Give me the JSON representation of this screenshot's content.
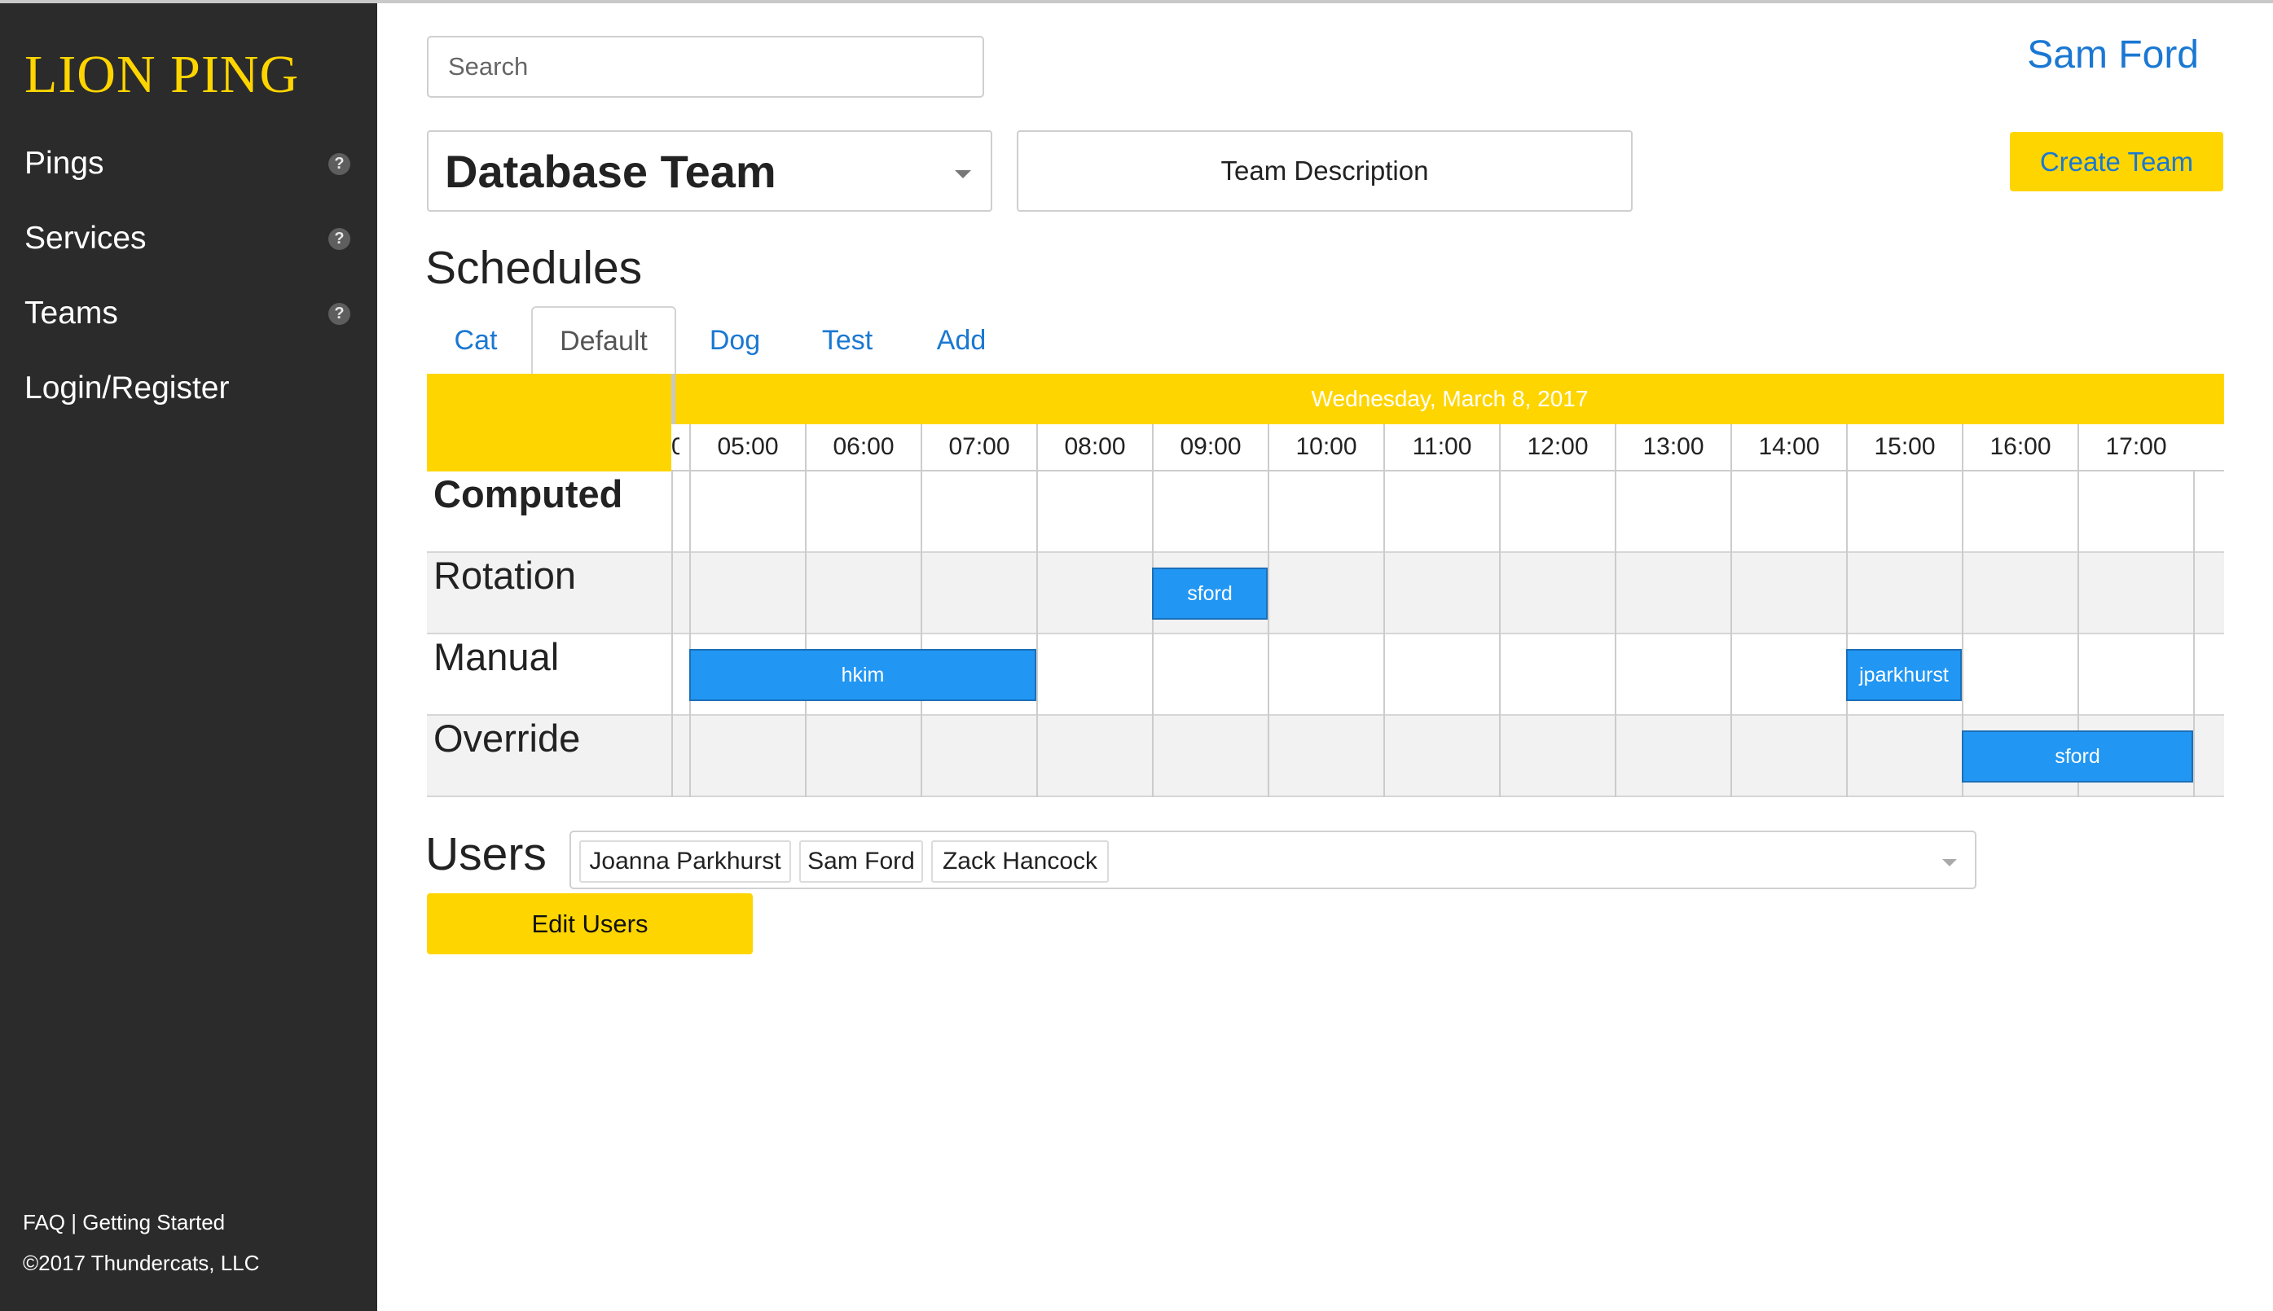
{
  "app": {
    "logo": "LION PING"
  },
  "sidebar": {
    "items": [
      {
        "label": "Pings",
        "has_help": true
      },
      {
        "label": "Services",
        "has_help": true
      },
      {
        "label": "Teams",
        "has_help": true
      },
      {
        "label": "Login/Register",
        "has_help": false
      }
    ],
    "help_glyph": "?",
    "footer": {
      "faq": "FAQ",
      "separator": "|",
      "getting_started": "Getting Started",
      "copyright": "©2017 Thundercats, LLC"
    }
  },
  "header": {
    "search_placeholder": "Search",
    "user_name": "Sam Ford"
  },
  "team": {
    "selected": "Database Team",
    "description_button": "Team Description",
    "create_button": "Create Team"
  },
  "schedules": {
    "title": "Schedules",
    "tabs": [
      {
        "label": "Cat",
        "active": false
      },
      {
        "label": "Default",
        "active": true
      },
      {
        "label": "Dog",
        "active": false
      },
      {
        "label": "Test",
        "active": false
      },
      {
        "label": "Add",
        "active": false
      }
    ],
    "calendar": {
      "date": "Wednesday, March 8, 2017",
      "partial_hour_label": "0",
      "hours": [
        "05:00",
        "06:00",
        "07:00",
        "08:00",
        "09:00",
        "10:00",
        "11:00",
        "12:00",
        "13:00",
        "14:00",
        "15:00",
        "16:00",
        "17:00"
      ],
      "rows": [
        {
          "label": "Computed",
          "bold": true,
          "shaded": false
        },
        {
          "label": "Rotation",
          "bold": false,
          "shaded": true
        },
        {
          "label": "Manual",
          "bold": false,
          "shaded": false
        },
        {
          "label": "Override",
          "bold": false,
          "shaded": true
        }
      ],
      "events": [
        {
          "row": 1,
          "name": "sford",
          "start": "09:00",
          "end": "10:00"
        },
        {
          "row": 2,
          "name": "hkim",
          "start": "05:00",
          "end": "08:00"
        },
        {
          "row": 2,
          "name": "jparkhurst",
          "start": "15:00",
          "end": "16:00"
        },
        {
          "row": 3,
          "name": "sford",
          "start": "16:00",
          "end": "18:00"
        }
      ]
    }
  },
  "users": {
    "title": "Users",
    "selected": [
      "Joanna Parkhurst",
      "Sam Ford",
      "Zack Hancock"
    ],
    "edit_button": "Edit Users"
  },
  "colors": {
    "accent": "#ffd500",
    "link": "#1a78d2",
    "event": "#2196f3",
    "sidebar_bg": "#2b2b2b"
  }
}
